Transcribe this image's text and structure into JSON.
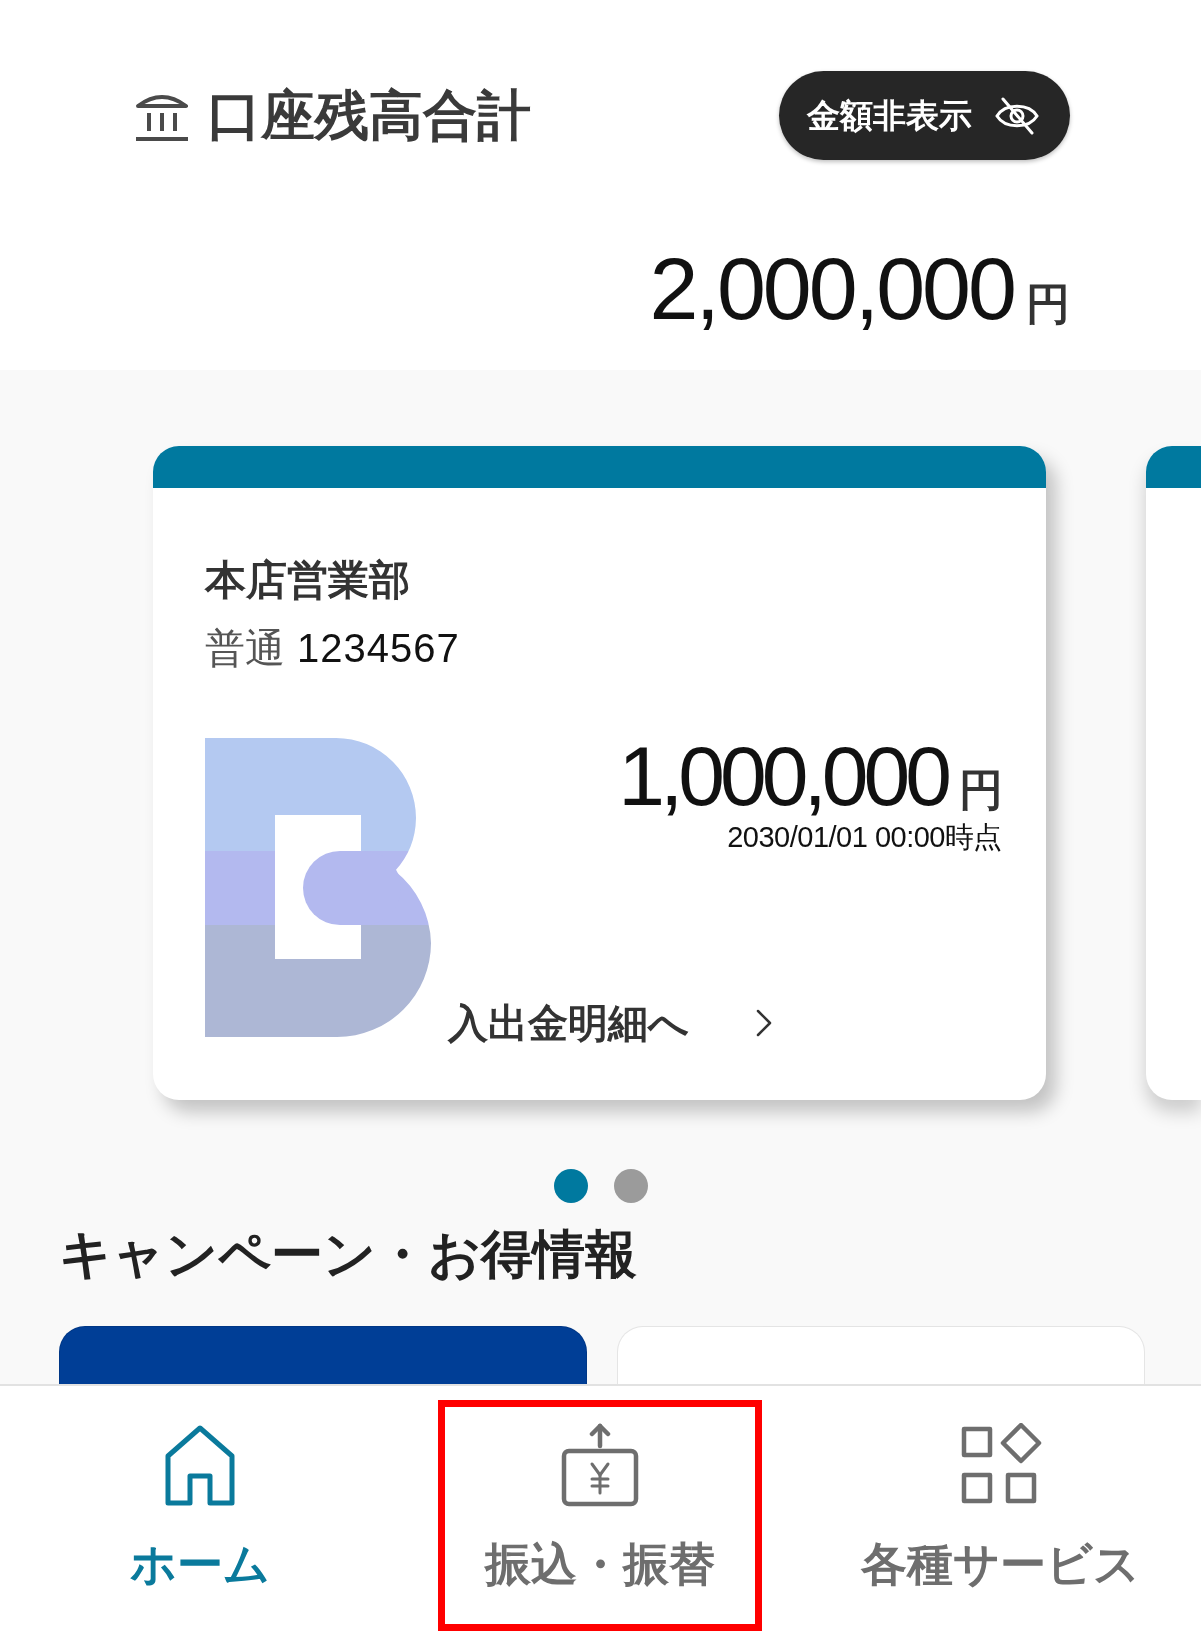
{
  "header": {
    "title": "口座残高合計",
    "hide_button": {
      "label": "金額非表示"
    },
    "total": {
      "amount": "2,000,000",
      "unit": "円"
    }
  },
  "accounts": [
    {
      "kind": "full",
      "branch": "本店営業部",
      "type": "普通",
      "number": "1234567",
      "balance": "1,000,000",
      "unit": "円",
      "as_of": "2030/01/01 00:00時点",
      "link": "入出金明細へ"
    },
    {
      "kind": "partial"
    }
  ],
  "carousel_dots": [
    {
      "selected": true
    },
    {
      "selected": false
    }
  ],
  "campaigns": {
    "title": "キャンペーン・お得情報",
    "banners": [
      {
        "color": "#003e96"
      },
      {
        "color": "#ffffff"
      }
    ]
  },
  "bottom_nav": [
    {
      "kind": "home",
      "label": "ホーム",
      "selected": true,
      "highlighted": false
    },
    {
      "kind": "transfer",
      "label": "振込・振替",
      "selected": false,
      "highlighted": true
    },
    {
      "kind": "services",
      "label": "各種サービス",
      "selected": false,
      "highlighted": false
    }
  ]
}
